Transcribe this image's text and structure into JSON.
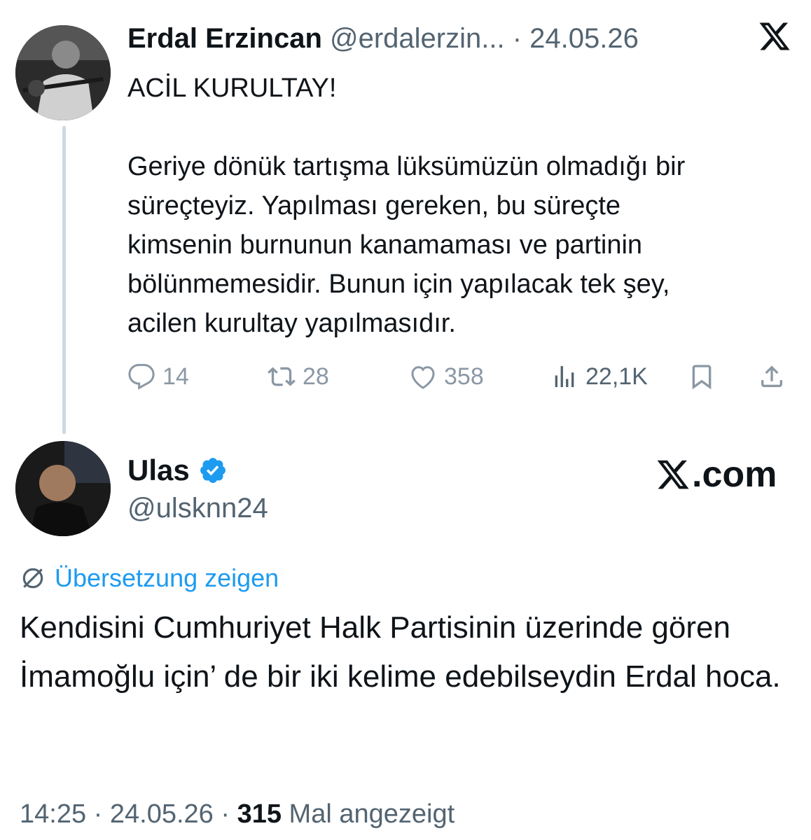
{
  "quoted_tweet": {
    "author_name": "Erdal Erzincan",
    "handle": "@erdalerzin...",
    "separator": "·",
    "date": "24.05.26",
    "title_line": "ACİL KURULTAY!",
    "body_lines": [
      "Geriye dönük tartışma lüksümüzün olmadığı bir",
      "süreçteyiz. Yapılması gereken, bu süreçte",
      "kimsenin burnunun kanamaması ve partinin",
      "bölünmemesidir. Bunun için yapılacak tek şey,",
      "acilen kurultay yapılmasıdır."
    ],
    "actions": {
      "replies": "14",
      "reposts": "28",
      "likes": "358",
      "views": "22,1K"
    }
  },
  "main_tweet": {
    "author_name": "Ulas",
    "handle": "@ulsknn24",
    "watermark": ".com",
    "translate_label": "Übersetzung zeigen",
    "text": "Kendisini Cumhuriyet Halk Partisinin üzerinde gören İmamoğlu için’ de bir iki kelime edebilseydin Erdal hoca.",
    "footer": {
      "time": "14:25",
      "sep1": "·",
      "date": "24.05.26",
      "sep2": "·",
      "view_count": "315",
      "view_label": "Mal angezeigt"
    }
  },
  "colors": {
    "text": "#0f1419",
    "secondary": "#536471",
    "muted_icon": "#8b98a5",
    "link_blue": "#1d9bf0",
    "verified_blue": "#1d9bf0",
    "thread_line": "#cfd9de"
  },
  "icons": [
    "x-logo-icon",
    "reply-icon",
    "repost-icon",
    "like-icon",
    "views-icon",
    "bookmark-icon",
    "share-icon",
    "verified-badge-icon",
    "translate-icon"
  ]
}
